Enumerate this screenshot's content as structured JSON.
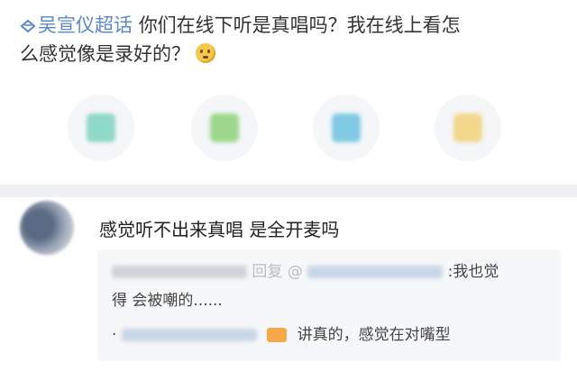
{
  "post": {
    "topic": "吴宣仪超话",
    "text_line1": "你们在线下听是真唱吗？我在线上看怎",
    "text_line2": "么感觉像是录好的？"
  },
  "share_icons": [
    {
      "name": "wechat-share-icon",
      "color": "#7fd3c0"
    },
    {
      "name": "moments-share-icon",
      "color": "#8fd27a"
    },
    {
      "name": "qq-share-icon",
      "color": "#6cc3e0"
    },
    {
      "name": "qzone-share-icon",
      "color": "#f2d27a"
    }
  ],
  "comment": {
    "text": "感觉听不出来真唱 是全开麦吗",
    "reply1_kw": "回复",
    "reply1_at": "@",
    "reply1_tail": ":我也觉",
    "reply1_line2": "得 会被嘲的......",
    "reply2_prefix": "·",
    "reply2_tail": "讲真的，感觉在对嘴型"
  }
}
